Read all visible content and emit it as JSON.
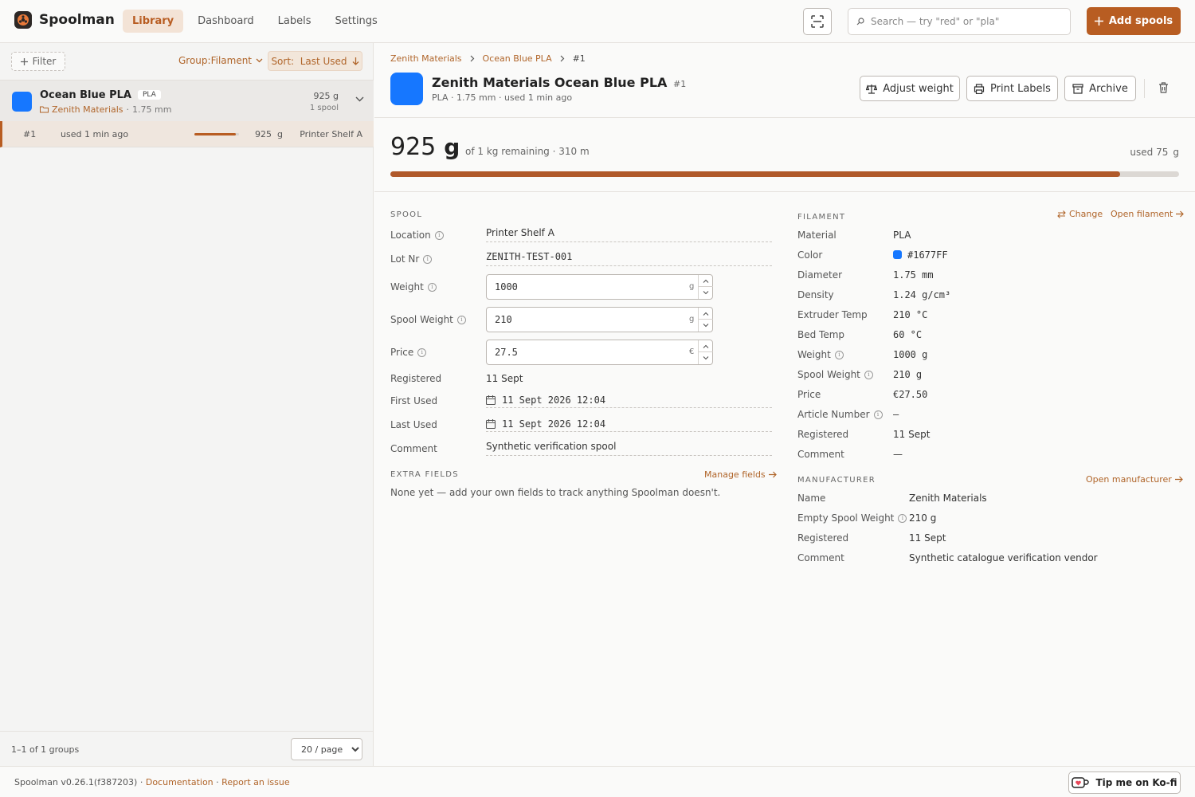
{
  "app": {
    "name": "Spoolman"
  },
  "nav": [
    {
      "label": "Library",
      "active": true
    },
    {
      "label": "Dashboard",
      "active": false
    },
    {
      "label": "Labels",
      "active": false
    },
    {
      "label": "Settings",
      "active": false
    }
  ],
  "search": {
    "placeholder": "Search — try \"red\" or \"pla\"",
    "value": ""
  },
  "add_button": "Add spools",
  "sidebar": {
    "filter_label": "Filter",
    "group_label": "Group:Filament",
    "sort_label": "Sort:  Last Used",
    "group": {
      "name": "Ocean Blue PLA",
      "material_badge": "PLA",
      "vendor": "Zenith Materials",
      "separator": "·",
      "diameter": "1.75 mm",
      "weight": "925 g",
      "spool_count": "1 spool",
      "color": "#1677FF"
    },
    "spools": [
      {
        "id": "#1",
        "used": "used 1 min ago",
        "remaining_fraction": 0.925,
        "weight": "925  g",
        "location": "Printer Shelf A"
      }
    ],
    "count_text": "1–1 of 1 groups",
    "page_size": "20 / page"
  },
  "detail": {
    "breadcrumbs": [
      "Zenith Materials",
      "Ocean Blue PLA",
      "#1"
    ],
    "title": "Zenith Materials Ocean Blue PLA",
    "id": "#1",
    "subtitle": "PLA · 1.75 mm · used 1 min ago",
    "color": "#1677FF",
    "actions": {
      "adjust": "Adjust weight",
      "print": "Print Labels",
      "archive": "Archive"
    },
    "remaining_value": "925",
    "remaining_unit": "g",
    "remaining_text": "of 1 kg remaining · 310 m",
    "used_label": "used 75",
    "used_unit": "g",
    "remaining_fraction": 0.925
  },
  "spool": {
    "section_title": "SPOOL",
    "location": {
      "label": "Location",
      "value": "Printer Shelf A"
    },
    "lot": {
      "label": "Lot Nr",
      "value": "ZENITH-TEST-001"
    },
    "weight": {
      "label": "Weight",
      "value": "1000",
      "unit": "g"
    },
    "spool_weight": {
      "label": "Spool Weight",
      "value": "210",
      "unit": "g"
    },
    "price": {
      "label": "Price",
      "value": "27.5",
      "unit": "€"
    },
    "registered": {
      "label": "Registered",
      "value": "11 Sept"
    },
    "first_used": {
      "label": "First Used",
      "value": "11 Sept 2026 12:04"
    },
    "last_used": {
      "label": "Last Used",
      "value": "11 Sept 2026 12:04"
    },
    "comment": {
      "label": "Comment",
      "value": "Synthetic verification spool"
    }
  },
  "extra_fields": {
    "title": "EXTRA FIELDS",
    "manage": "Manage fields",
    "empty_text": "None yet — add your own fields to track anything Spoolman doesn't."
  },
  "filament": {
    "section_title": "FILAMENT",
    "change": "Change",
    "open": "Open filament",
    "rows": [
      {
        "label": "Material",
        "value": "PLA",
        "info": false
      },
      {
        "label": "Color",
        "value": "#1677FF",
        "info": false
      },
      {
        "label": "Diameter",
        "value": "1.75 mm",
        "info": false
      },
      {
        "label": "Density",
        "value": "1.24 g/cm³",
        "info": false
      },
      {
        "label": "Extruder Temp",
        "value": "210 °C",
        "info": false
      },
      {
        "label": "Bed Temp",
        "value": "60 °C",
        "info": false
      },
      {
        "label": "Weight",
        "value": "1000 g",
        "info": true
      },
      {
        "label": "Spool Weight",
        "value": "210 g",
        "info": true
      },
      {
        "label": "Price",
        "value": "€27.50",
        "info": false
      },
      {
        "label": "Article Number",
        "value": "–",
        "info": true
      },
      {
        "label": "Registered",
        "value": "11 Sept",
        "info": false
      },
      {
        "label": "Comment",
        "value": "—",
        "info": false
      }
    ]
  },
  "manufacturer": {
    "section_title": "MANUFACTURER",
    "open": "Open manufacturer",
    "rows": [
      {
        "label": "Name",
        "value": "Zenith Materials",
        "info": false
      },
      {
        "label": "Empty Spool Weight",
        "value": "210 g",
        "info": true
      },
      {
        "label": "Registered",
        "value": "11 Sept",
        "info": false
      },
      {
        "label": "Comment",
        "value": "Synthetic catalogue verification vendor",
        "info": false
      }
    ]
  },
  "footer": {
    "version": "Spoolman v0.26.1(f387203)",
    "separator": "·",
    "docs": "Documentation",
    "issue": "Report an issue",
    "kofi": "Tip me on Ko-fi"
  },
  "colors": {
    "accent": "#b85d22",
    "filament": "#1677FF"
  }
}
